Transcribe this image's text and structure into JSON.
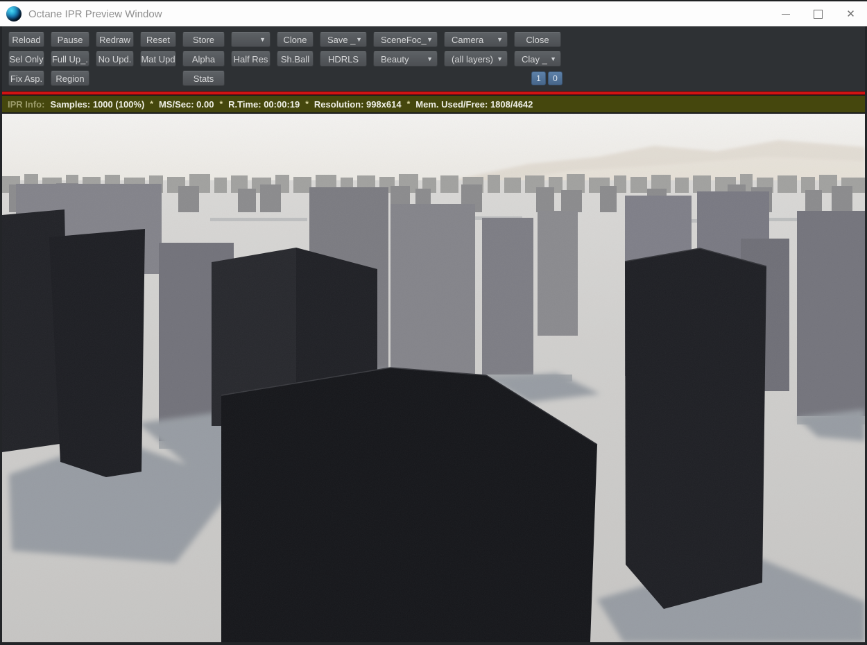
{
  "window": {
    "title": "Octane IPR Preview Window"
  },
  "icons": {
    "dropdown_arrow": "▼",
    "close": "✕"
  },
  "toolbar": {
    "row1": [
      {
        "label": "Reload"
      },
      {
        "label": "Pause"
      },
      {
        "label": "Redraw"
      },
      {
        "label": "Reset"
      },
      {
        "label": "Store"
      },
      {
        "label": "",
        "dropdown": true
      },
      {
        "label": "Clone"
      },
      {
        "label": "Save _",
        "dropdown": true
      },
      {
        "label": "SceneFoc_",
        "dropdown": true
      },
      {
        "label": "Camera",
        "dropdown": true
      },
      {
        "label": "Close"
      }
    ],
    "row2": [
      {
        "label": "Sel Only"
      },
      {
        "label": "Full Up_."
      },
      {
        "label": "No Upd."
      },
      {
        "label": "Mat Upd"
      },
      {
        "label": "Alpha"
      },
      {
        "label": "Half Res"
      },
      {
        "label": "Sh.Ball"
      },
      {
        "label": "HDRLS"
      },
      {
        "label": "Beauty",
        "dropdown": true
      },
      {
        "label": "(all layers)",
        "dropdown": true
      },
      {
        "label": "Clay _",
        "dropdown": true
      }
    ],
    "row3": {
      "fix_asp": "Fix Asp.",
      "region": "Region",
      "stats": "Stats",
      "toggle_one": "1",
      "toggle_zero": "0"
    }
  },
  "status_bar": {
    "label": "IPR Info:",
    "samples": "Samples: 1000 (100%)",
    "ms_sec": "MS/Sec: 0.00",
    "r_time": "R.Time: 00:00:19",
    "resolution": "Resolution: 998x614",
    "memory": "Mem. Used/Free: 1808/4642",
    "separator": "*"
  },
  "colors": {
    "progress_red": "#d01313",
    "status_olive": "#45470d",
    "toggle_blue": "#47668a",
    "toolbar_bg": "#2e3134",
    "scene_sky": "#f2f1ef",
    "scene_ground": "#cbcac8",
    "scene_pillar_dark": "#1b1c21",
    "scene_pillar_gray": "#7a7a80",
    "scene_shadow": "#989da4",
    "scene_mountain_haze": "#d8cfc2"
  }
}
